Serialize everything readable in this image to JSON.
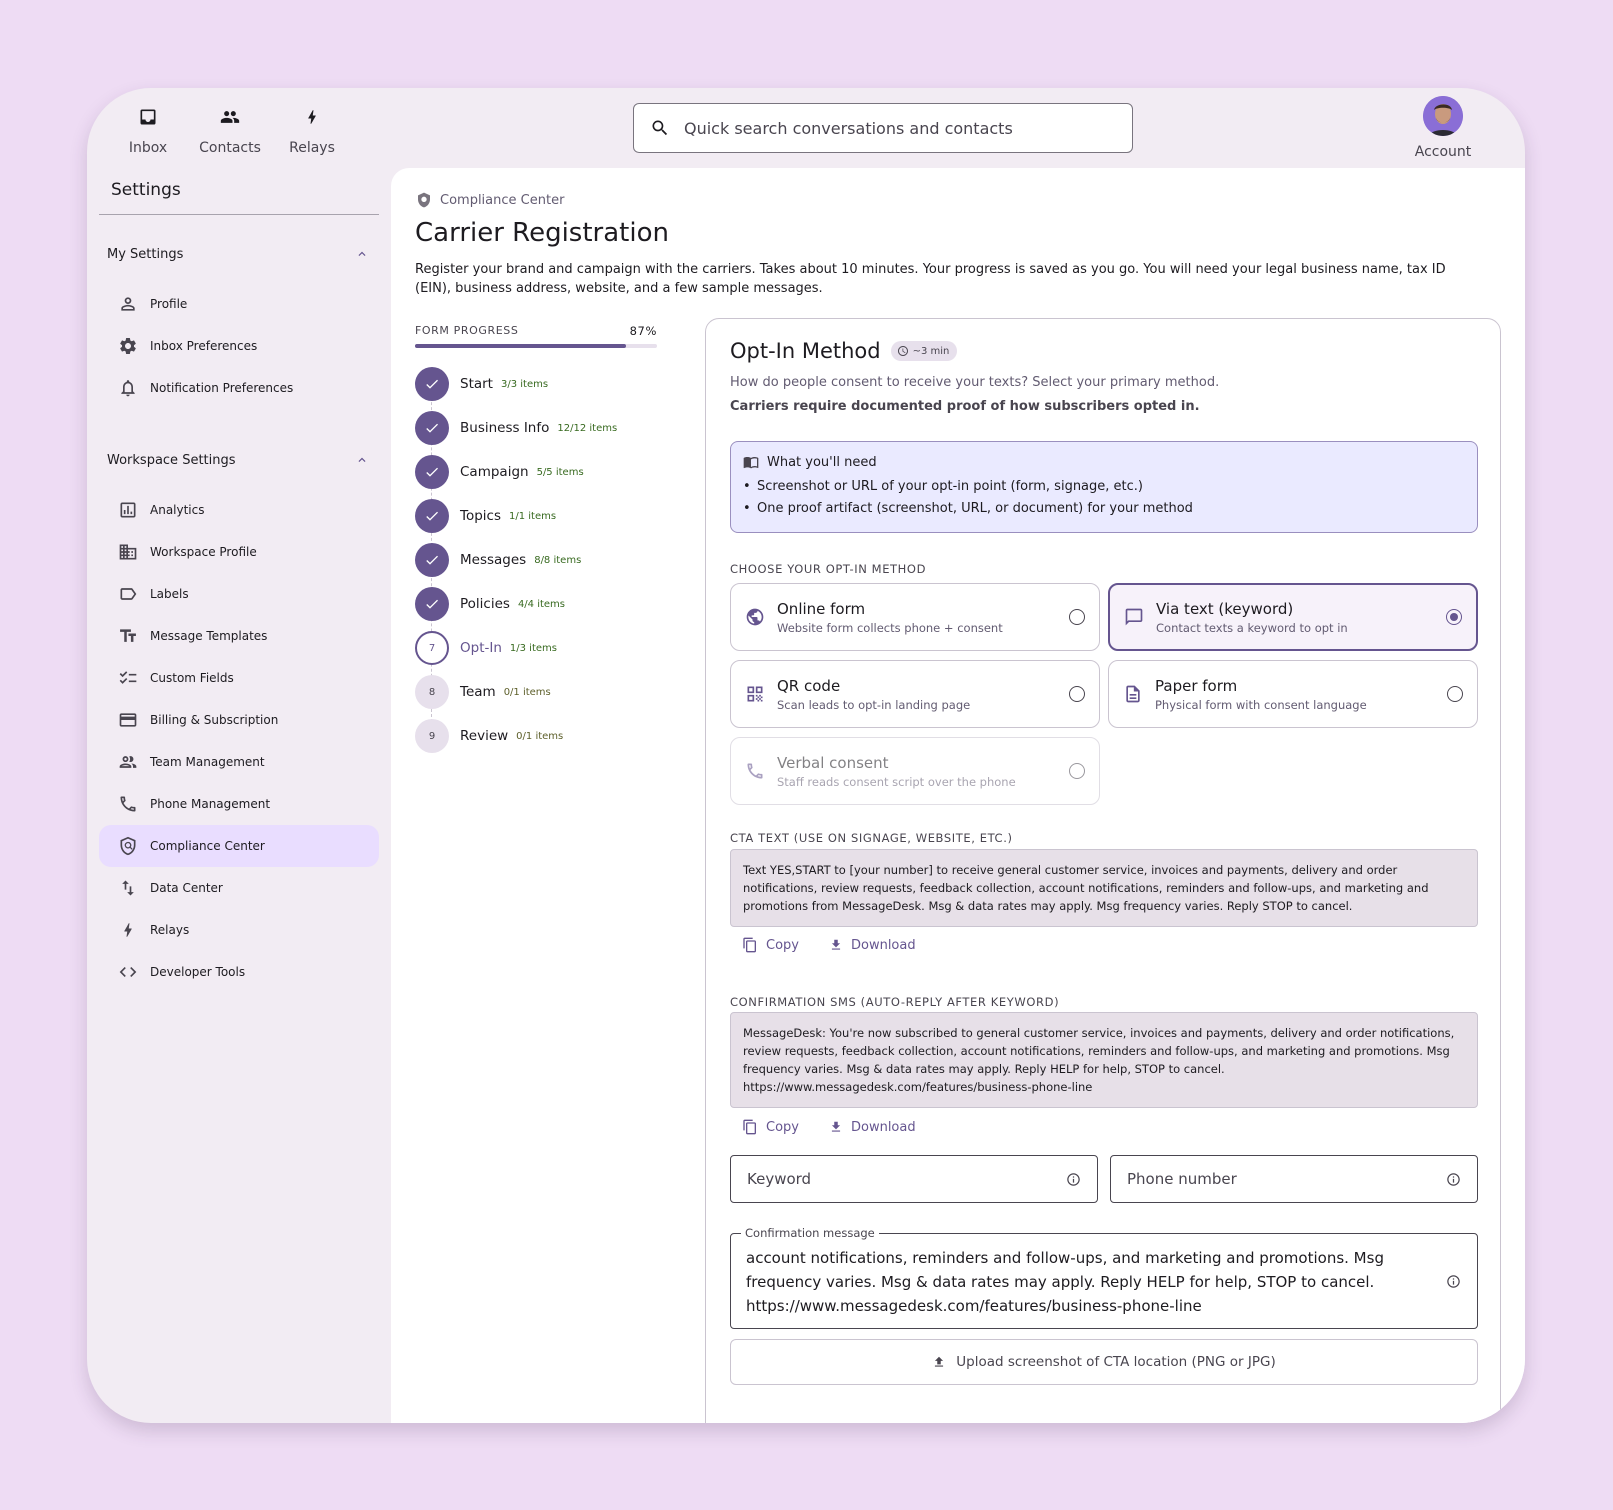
{
  "nav": {
    "items": [
      {
        "label": "Inbox",
        "icon": "inbox-icon"
      },
      {
        "label": "Contacts",
        "icon": "people-icon"
      },
      {
        "label": "Relays",
        "icon": "bolt-icon"
      }
    ],
    "search_placeholder": "Quick search conversations and contacts",
    "account_label": "Account"
  },
  "sidebar": {
    "title": "Settings",
    "my_settings": {
      "title": "My Settings",
      "items": [
        {
          "label": "Profile",
          "icon": "person-icon"
        },
        {
          "label": "Inbox Preferences",
          "icon": "gear-icon"
        },
        {
          "label": "Notification Preferences",
          "icon": "bell-icon"
        }
      ]
    },
    "workspace_settings": {
      "title": "Workspace Settings",
      "items": [
        {
          "label": "Analytics",
          "icon": "analytics-icon"
        },
        {
          "label": "Workspace Profile",
          "icon": "building-icon"
        },
        {
          "label": "Labels",
          "icon": "label-icon"
        },
        {
          "label": "Message Templates",
          "icon": "text-format-icon"
        },
        {
          "label": "Custom Fields",
          "icon": "checklist-icon"
        },
        {
          "label": "Billing & Subscription",
          "icon": "credit-card-icon"
        },
        {
          "label": "Team Management",
          "icon": "team-icon"
        },
        {
          "label": "Phone Management",
          "icon": "phone-icon"
        },
        {
          "label": "Compliance Center",
          "icon": "shield-icon",
          "active": true
        },
        {
          "label": "Data Center",
          "icon": "swap-vertical-icon"
        },
        {
          "label": "Relays",
          "icon": "bolt-icon"
        },
        {
          "label": "Developer Tools",
          "icon": "code-icon"
        }
      ]
    }
  },
  "page": {
    "breadcrumb": "Compliance Center",
    "title": "Carrier Registration",
    "description": "Register your brand and campaign with the carriers. Takes about 10 minutes. Your progress is saved as you go. You will need your legal business name, tax ID (EIN), business address, website, and a few sample messages."
  },
  "progress": {
    "label": "FORM PROGRESS",
    "percent_text": "87%",
    "percent": 87,
    "steps": [
      {
        "name": "Start",
        "count": "3/3 items",
        "status": "done",
        "number": "1"
      },
      {
        "name": "Business Info",
        "count": "12/12 items",
        "status": "done",
        "number": "2"
      },
      {
        "name": "Campaign",
        "count": "5/5 items",
        "status": "done",
        "number": "3"
      },
      {
        "name": "Topics",
        "count": "1/1 items",
        "status": "done",
        "number": "4"
      },
      {
        "name": "Messages",
        "count": "8/8 items",
        "status": "done",
        "number": "5"
      },
      {
        "name": "Policies",
        "count": "4/4 items",
        "status": "done",
        "number": "6"
      },
      {
        "name": "Opt-In",
        "count": "1/3 items",
        "status": "current",
        "number": "7"
      },
      {
        "name": "Team",
        "count": "0/1 items",
        "status": "todo",
        "number": "8"
      },
      {
        "name": "Review",
        "count": "0/1 items",
        "status": "todo",
        "number": "9"
      }
    ]
  },
  "card": {
    "title": "Opt-In Method",
    "time_chip": "~3 min",
    "subtitle": "How do people consent to receive your texts? Select your primary method.",
    "note": "Carriers require documented proof of how subscribers opted in.",
    "need": {
      "title": "What you'll need",
      "items": [
        "Screenshot or URL of your opt-in point (form, signage, etc.)",
        "One proof artifact (screenshot, URL, or document) for your method"
      ]
    },
    "choose_label": "CHOOSE YOUR OPT-IN METHOD",
    "options": [
      {
        "title": "Online form",
        "sub": "Website form collects phone + consent",
        "icon": "globe-icon",
        "selected": false
      },
      {
        "title": "Via text (keyword)",
        "sub": "Contact texts a keyword to opt in",
        "icon": "chat-bubble-icon",
        "selected": true
      },
      {
        "title": "QR code",
        "sub": "Scan leads to opt-in landing page",
        "icon": "qr-code-icon",
        "selected": false
      },
      {
        "title": "Paper form",
        "sub": "Physical form with consent language",
        "icon": "document-icon",
        "selected": false
      },
      {
        "title": "Verbal consent",
        "sub": "Staff reads consent script over the phone",
        "icon": "phone-icon",
        "selected": false,
        "disabled": true
      }
    ],
    "cta_label": "CTA TEXT (USE ON SIGNAGE, WEBSITE, ETC.)",
    "cta_text": "Text YES,START to [your number] to receive general customer service, invoices and payments, delivery and order notifications, review requests, feedback collection, account notifications, reminders and follow-ups, and marketing and promotions from MessageDesk. Msg & data rates may apply. Msg frequency varies. Reply STOP to cancel.",
    "confirm_label": "CONFIRMATION SMS (AUTO-REPLY AFTER KEYWORD)",
    "confirm_text": "MessageDesk: You're now subscribed to general customer service, invoices and payments, delivery and order notifications, review requests, feedback collection, account notifications, reminders and follow-ups, and marketing and promotions. Msg frequency varies. Msg & data rates may apply. Reply HELP for help, STOP to cancel. https://www.messagedesk.com/features/business-phone-line",
    "copy_label": "Copy",
    "download_label": "Download",
    "keyword_placeholder": "Keyword",
    "phone_placeholder": "Phone number",
    "confirmation_field_label": "Confirmation message",
    "confirmation_field_value": "account notifications, reminders and follow-ups, and marketing and promotions. Msg frequency varies. Msg & data rates may apply. Reply HELP for help, STOP to cancel. https://www.messagedesk.com/features/business-phone-line",
    "upload_label": "Upload screenshot of CTA location (PNG or JPG)"
  },
  "colors": {
    "accent": "#65558f",
    "active_nav": "#e9ddff",
    "info_box": "#eaeaff",
    "success_count": "#386a20"
  }
}
